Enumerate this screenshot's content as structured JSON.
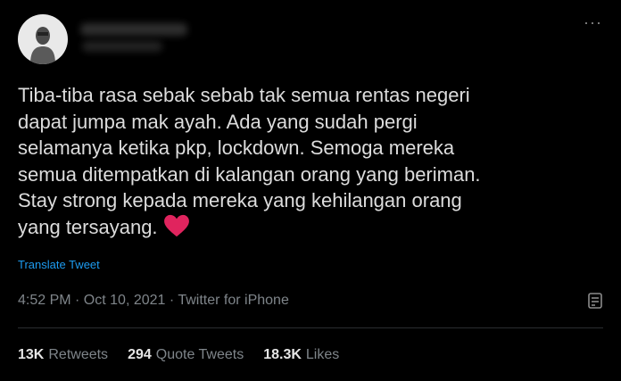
{
  "tweet": {
    "text": "Tiba-tiba rasa sebak sebab tak semua rentas negeri\ndapat jumpa mak ayah. Ada yang sudah pergi\nselamanya ketika pkp, lockdown. Semoga mereka\nsemua ditempatkan di kalangan orang yang beriman.\nStay strong kepada mereka yang kehilangan orang\nyang tersayang.",
    "emoji": "heart-icon",
    "translate_label": "Translate Tweet",
    "meta": "4:52 PM · Oct 10, 2021 · Twitter for iPhone"
  },
  "stats": {
    "retweets_count": "13K",
    "retweets_label": "Retweets",
    "quotes_count": "294",
    "quotes_label": "Quote Tweets",
    "likes_count": "18.3K",
    "likes_label": "Likes"
  },
  "colors": {
    "background": "#000000",
    "text": "#dcdcdc",
    "link": "#1d9bf0",
    "muted": "#7f858a",
    "heart": "#e0245e"
  }
}
